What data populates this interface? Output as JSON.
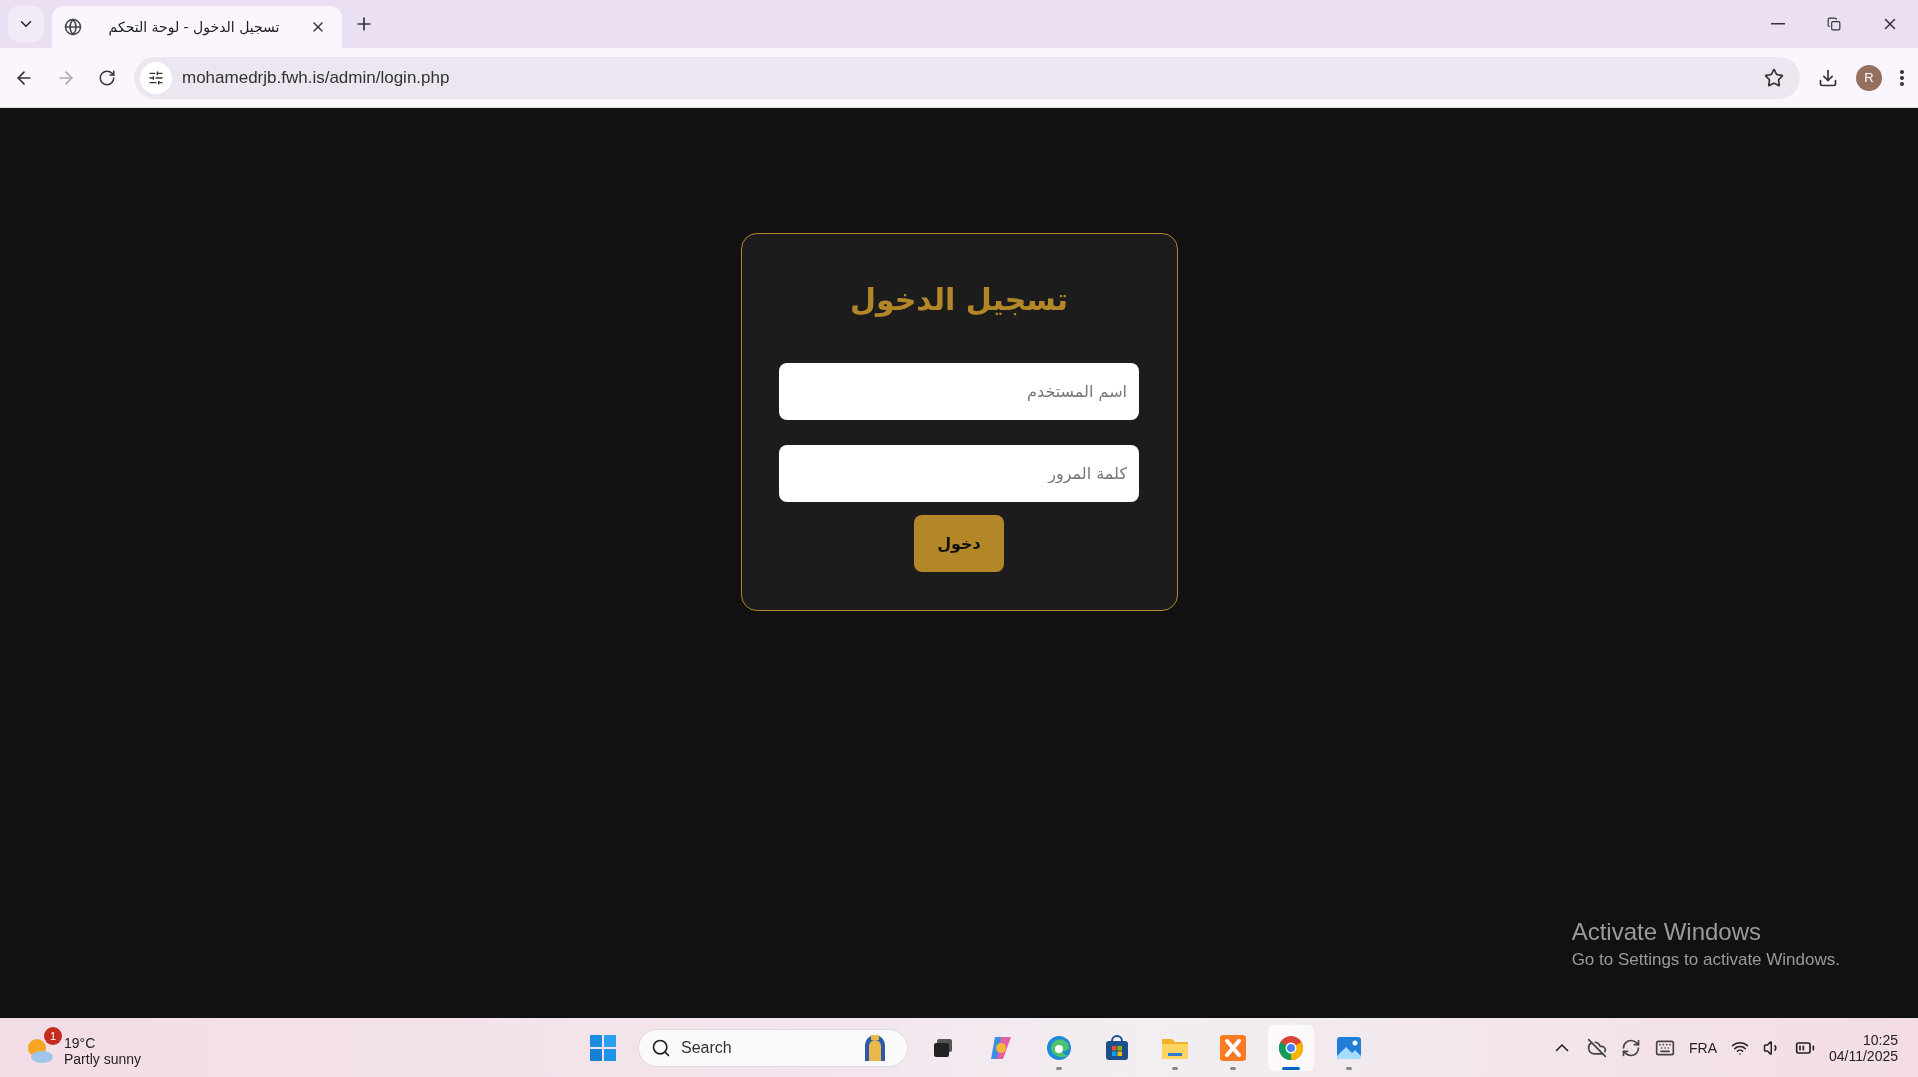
{
  "browser": {
    "tab_title": "تسجيل الدخول - لوحة التحكم",
    "url": "mohamedrjb.fwh.is/admin/login.php",
    "profile_initial": "R"
  },
  "login": {
    "title": "تسجيل الدخول",
    "fields": [
      {
        "placeholder": "اسم المستخدم"
      },
      {
        "placeholder": "كلمة المرور"
      }
    ],
    "button": "دخول"
  },
  "activation": {
    "title": "Activate Windows",
    "subtitle": "Go to Settings to activate Windows."
  },
  "taskbar": {
    "weather": {
      "temperature": "19°C",
      "condition": "Partly sunny",
      "badge": "1"
    },
    "search": {
      "placeholder": "Search"
    },
    "apps": [
      {
        "kind": "taskview",
        "running": false,
        "selected": false
      },
      {
        "kind": "copilot",
        "running": false,
        "selected": false
      },
      {
        "kind": "edge",
        "running": true,
        "selected": false
      },
      {
        "kind": "store",
        "running": false,
        "selected": false
      },
      {
        "kind": "files",
        "running": true,
        "selected": false
      },
      {
        "kind": "xampp",
        "running": true,
        "selected": false
      },
      {
        "kind": "chrome",
        "running": true,
        "selected": true
      },
      {
        "kind": "photos",
        "running": true,
        "selected": false
      }
    ],
    "language": "FRA",
    "time": "10:25",
    "date": "04/11/2025"
  }
}
